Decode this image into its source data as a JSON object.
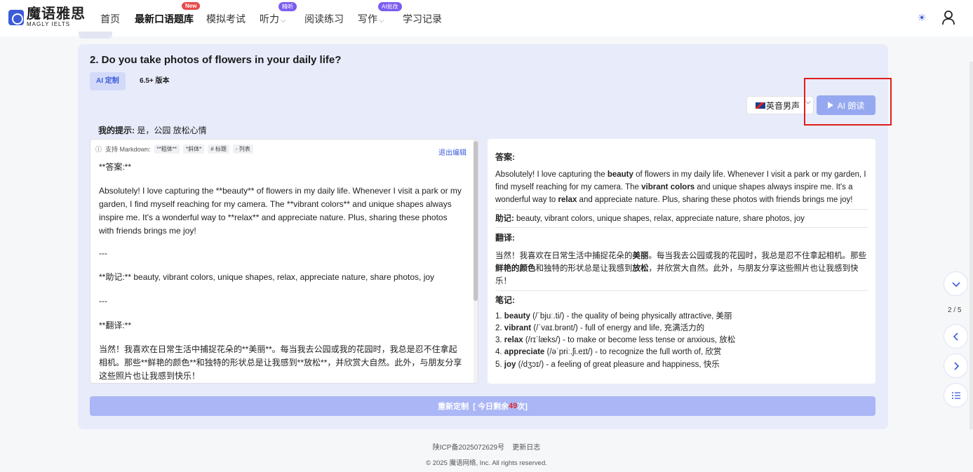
{
  "nav": {
    "logo_cn": "魔语雅思",
    "logo_en": "MAGLY IELTS",
    "items": [
      {
        "label": "首页"
      },
      {
        "label": "最新口语题库",
        "badge": "New"
      },
      {
        "label": "模拟考试"
      },
      {
        "label": "听力",
        "badge": "精听"
      },
      {
        "label": "阅读练习"
      },
      {
        "label": "写作",
        "badge": "AI批改"
      },
      {
        "label": "学习记录"
      }
    ]
  },
  "question": {
    "title": "2. Do you take photos of flowers in your daily life?",
    "tabs": [
      "AI 定制",
      "6.5+ 版本"
    ]
  },
  "voice": {
    "selected": "英音男声",
    "read_button": "AI 朗读"
  },
  "hint": {
    "label": "我的提示:",
    "value": "是，公园 放松心情"
  },
  "editor": {
    "md_support": "支持 Markdown:",
    "md_tags": [
      "**粗体**",
      "*斜体*",
      "# 标题",
      "- 列表"
    ],
    "exit_label": "退出编辑",
    "lines": [
      "**答案:**",
      "Absolutely! I love capturing the **beauty** of flowers in my daily life. Whenever I visit a park or my garden, I find myself reaching for my camera. The **vibrant colors** and unique shapes always inspire me. It's a wonderful way to **relax** and appreciate nature. Plus, sharing these photos with friends brings me joy!",
      "---",
      "**助记:** beauty, vibrant colors, unique shapes, relax, appreciate nature, share photos, joy",
      "---",
      "**翻译:**",
      "当然！我喜欢在日常生活中捕捉花朵的**美丽**。每当我去公园或我的花园时，我总是忍不住拿起相机。那些**鲜艳的颜色**和独特的形状总是让我感到**放松**，并欣赏大自然。此外，与朋友分享这些照片也让我感到快乐！"
    ]
  },
  "preview": {
    "answer_heading": "答案:",
    "answer_parts": [
      "Absolutely! I love capturing the ",
      "beauty",
      " of flowers in my daily life. Whenever I visit a park or my garden, I find myself reaching for my camera. The ",
      "vibrant colors",
      " and unique shapes always inspire me. It's a wonderful way to ",
      "relax",
      " and appreciate nature. Plus, sharing these photos with friends brings me joy!"
    ],
    "mnemonic_label": "助记:",
    "mnemonic_text": " beauty, vibrant colors, unique shapes, relax, appreciate nature, share photos, joy",
    "translation_heading": "翻译:",
    "translation_parts": [
      "当然！我喜欢在日常生活中捕捉花朵的",
      "美丽",
      "。每当我去公园或我的花园时，我总是忍不住拿起相机。那些",
      "鲜艳的颜色",
      "和独特的形状总是让我感到",
      "放松",
      "，并欣赏大自然。此外，与朋友分享这些照片也让我感到快乐！"
    ],
    "notes_heading": "笔记:",
    "notes": [
      {
        "num": "1. ",
        "word": "beauty",
        "rest": " (/ˈbjuː.ti/) - the quality of being physically attractive, 美丽"
      },
      {
        "num": "2. ",
        "word": "vibrant",
        "rest": " (/ˈvaɪ.brənt/) - full of energy and life, 充满活力的"
      },
      {
        "num": "3. ",
        "word": "relax",
        "rest": " (/rɪˈlæks/) - to make or become less tense or anxious, 放松"
      },
      {
        "num": "4. ",
        "word": "appreciate",
        "rest": " (/əˈpriː.ʃi.eɪt/) - to recognize the full worth of, 欣赏"
      },
      {
        "num": "5. ",
        "word": "joy",
        "rest": " (/dʒɔɪ/) - a feeling of great pleasure and happiness, 快乐"
      }
    ]
  },
  "regen": {
    "label": "重新定制",
    "prefix": "[ 今日剩余 ",
    "count": "49",
    "suffix": " 次]"
  },
  "pager": {
    "indicator": "2 / 5"
  },
  "footer": {
    "icp": "陕ICP备2025072629号",
    "changelog": "更新日志",
    "copyright": "© 2025 魔语网络, Inc. All rights reserved."
  },
  "colors": {
    "accent": "#3b5bdb",
    "highlight": "#e01e1e"
  },
  "icons": [
    "sun-icon",
    "user-icon",
    "play-icon",
    "chevron-down-icon",
    "chevron-left-icon",
    "chevron-right-icon",
    "list-icon",
    "info-icon",
    "flag-uk-icon"
  ]
}
